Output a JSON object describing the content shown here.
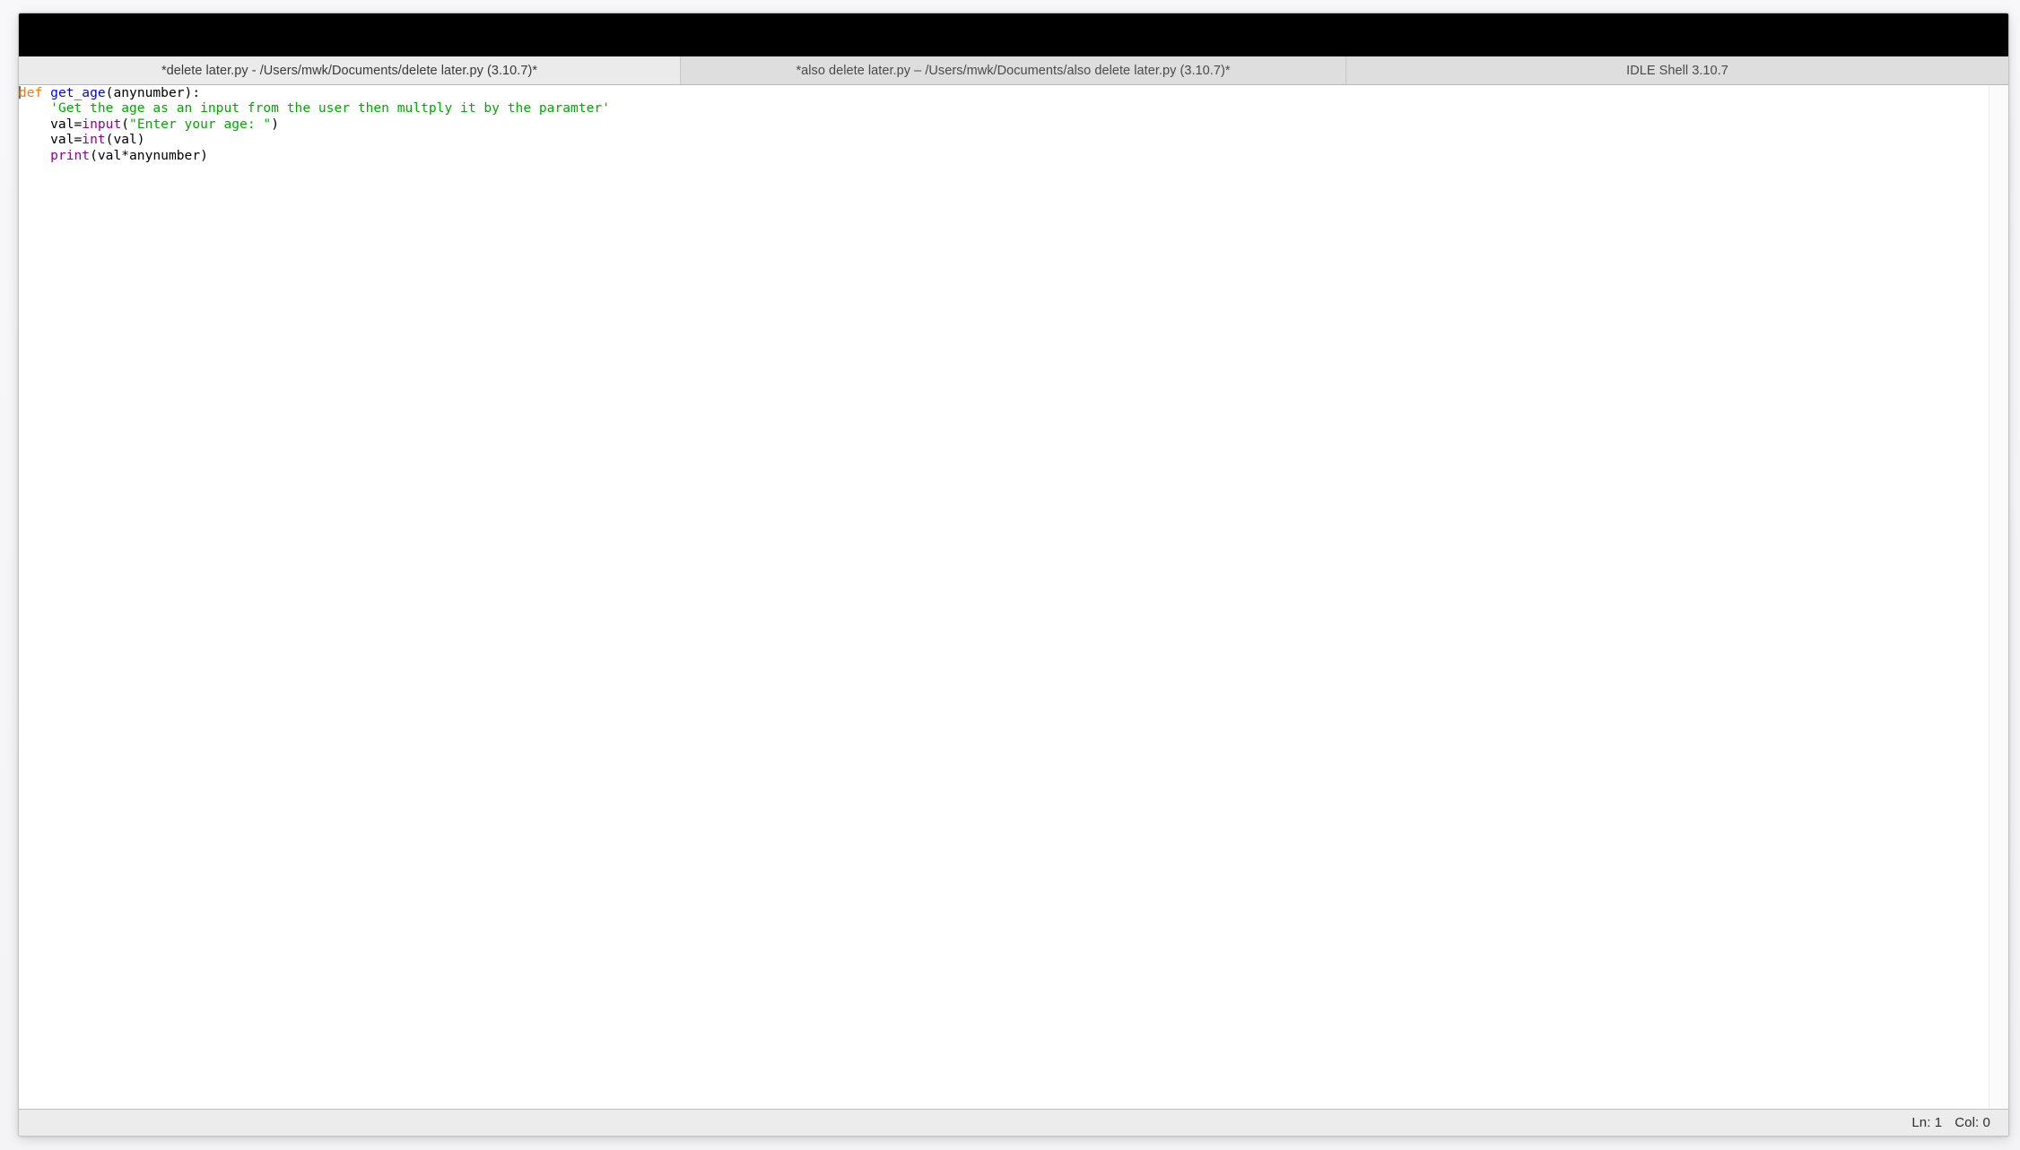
{
  "window": {
    "titlebar_text": "",
    "background_color": "#f7f7f9",
    "frame_color": "#ffffff"
  },
  "tabs": [
    {
      "id": "tab-0",
      "label": "*delete later.py - /Users/mwk/Documents/delete later.py (3.10.7)*",
      "active": true
    },
    {
      "id": "tab-1",
      "label": "*also delete later.py – /Users/mwk/Documents/also delete later.py (3.10.7)*",
      "active": false
    },
    {
      "id": "tab-2",
      "label": "IDLE Shell 3.10.7",
      "active": false
    }
  ],
  "editor": {
    "lines": [
      {
        "number": 1,
        "tokens": [
          {
            "text": "def",
            "type": "keyword"
          },
          {
            "text": " ",
            "type": "plain"
          },
          {
            "text": "get_age",
            "type": "defname"
          },
          {
            "text": "(anynumber):",
            "type": "plain"
          }
        ]
      },
      {
        "number": 2,
        "tokens": [
          {
            "text": "    ",
            "type": "plain"
          },
          {
            "text": "'Get the age as an input from the user then multply it by the paramter'",
            "type": "string"
          }
        ]
      },
      {
        "number": 3,
        "tokens": [
          {
            "text": "    val=",
            "type": "plain"
          },
          {
            "text": "input",
            "type": "builtin"
          },
          {
            "text": "(",
            "type": "plain"
          },
          {
            "text": "\"Enter your age: \"",
            "type": "string"
          },
          {
            "text": ")",
            "type": "plain"
          }
        ]
      },
      {
        "number": 4,
        "tokens": [
          {
            "text": "    val=",
            "type": "plain"
          },
          {
            "text": "int",
            "type": "builtin"
          },
          {
            "text": "(val)",
            "type": "plain"
          }
        ]
      },
      {
        "number": 5,
        "tokens": [
          {
            "text": "    ",
            "type": "plain"
          },
          {
            "text": "print",
            "type": "builtin"
          },
          {
            "text": "(val*anynumber)",
            "type": "plain"
          }
        ]
      }
    ],
    "plain_text": "def get_age(anynumber):\n    'Get the age as an input from the user then multply it by the paramter'\n    val=input(\"Enter your age: \")\n    val=int(val)\n    print(val*anynumber)",
    "caret_line": 1,
    "caret_col": 0,
    "syntax_colors": {
      "keyword": "#ff7700",
      "definition": "#0000ff",
      "string": "#00aa00",
      "builtin": "#900090",
      "plain": "#000000",
      "background": "#ffffff"
    }
  },
  "statusbar": {
    "line_label": "Ln: 1",
    "col_label": "Col: 0"
  }
}
